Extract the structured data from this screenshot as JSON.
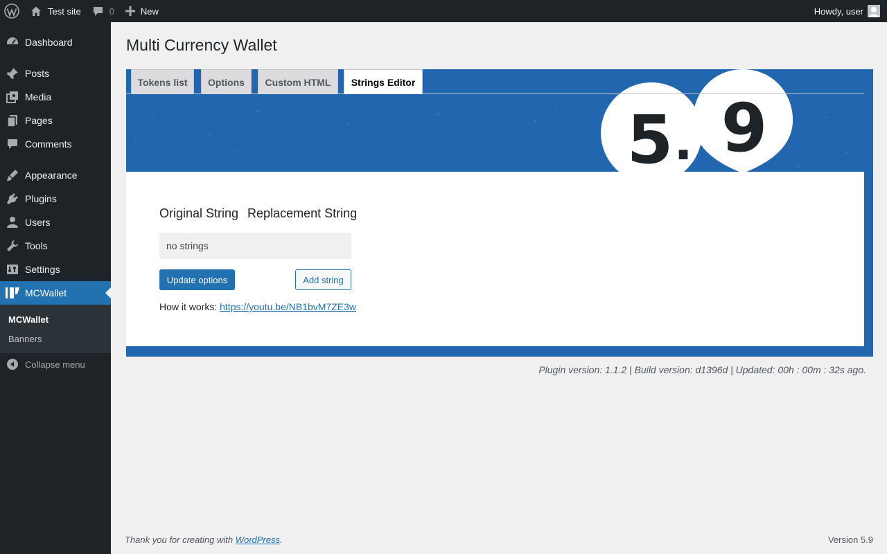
{
  "adminbar": {
    "site_name": "Test site",
    "comments_count": "0",
    "new_label": "New",
    "greeting": "Howdy, user"
  },
  "sidebar": {
    "items": [
      {
        "label": "Dashboard",
        "icon": "dashboard-icon"
      },
      {
        "label": "Posts",
        "icon": "pin-icon"
      },
      {
        "label": "Media",
        "icon": "media-icon"
      },
      {
        "label": "Pages",
        "icon": "pages-icon"
      },
      {
        "label": "Comments",
        "icon": "comment-icon"
      },
      {
        "label": "Appearance",
        "icon": "brush-icon"
      },
      {
        "label": "Plugins",
        "icon": "plugin-icon"
      },
      {
        "label": "Users",
        "icon": "user-icon"
      },
      {
        "label": "Tools",
        "icon": "wrench-icon"
      },
      {
        "label": "Settings",
        "icon": "settings-icon"
      },
      {
        "label": "MCWallet",
        "icon": "wallet-icon"
      }
    ],
    "submenu": [
      "MCWallet",
      "Banners"
    ],
    "collapse_label": "Collapse menu"
  },
  "page": {
    "title": "Multi Currency Wallet",
    "tabs": [
      "Tokens list",
      "Options",
      "Custom HTML",
      "Strings Editor"
    ],
    "active_tab": "Strings Editor",
    "version_art": [
      "5",
      ".",
      "9"
    ],
    "col_original": "Original String",
    "col_replacement": "Replacement String",
    "empty_text": "no strings",
    "update_button": "Update options",
    "add_button": "Add string",
    "how_label": "How it works:",
    "how_link": "https://youtu.be/NB1bvM7ZE3w",
    "plugin_info": "Plugin version: 1.1.2 | Build version: d1396d | Updated: 00h : 00m : 32s ago."
  },
  "footer": {
    "thanks_prefix": "Thank you for creating with",
    "thanks_link": "WordPress",
    "thanks_suffix": ".",
    "version": "Version 5.9"
  },
  "colors": {
    "adminbar_bg": "#1d2327",
    "accent": "#2271b1",
    "banner_blue": "#2166ae"
  }
}
